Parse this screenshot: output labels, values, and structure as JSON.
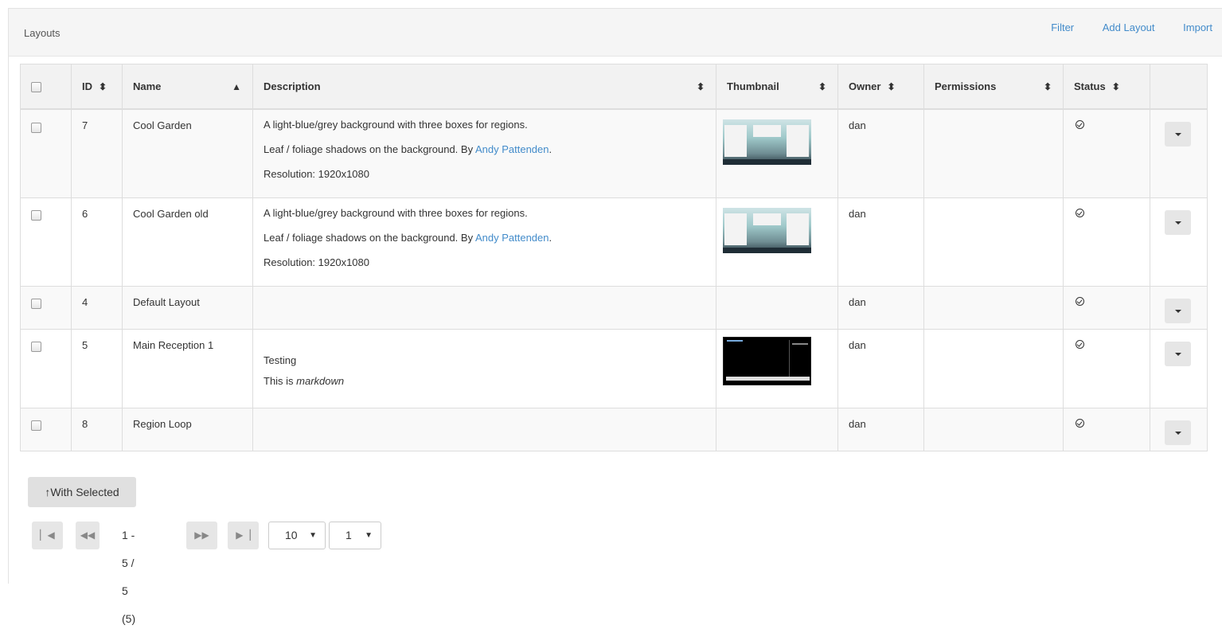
{
  "header": {
    "title": "Layouts",
    "links": [
      "Filter",
      "Add Layout",
      "Import"
    ]
  },
  "table": {
    "columns": [
      "ID",
      "Name",
      "Description",
      "Thumbnail",
      "Owner",
      "Permissions",
      "Status"
    ],
    "rows": [
      {
        "id": "7",
        "name": "Cool Garden",
        "desc1": "A light-blue/grey background with three boxes for regions.",
        "desc2_pre": "Leaf / foliage shadows on the background. By ",
        "desc2_link": "Andy Pattenden",
        "desc2_post": ".",
        "desc3": "Resolution: 1920x1080",
        "owner": "dan"
      },
      {
        "id": "6",
        "name": "Cool Garden old",
        "desc1": "A light-blue/grey background with three boxes for regions.",
        "desc2_pre": "Leaf / foliage shadows on the background. By ",
        "desc2_link": "Andy Pattenden",
        "desc2_post": ".",
        "desc3": "Resolution: 1920x1080",
        "owner": "dan"
      },
      {
        "id": "4",
        "name": "Default Layout",
        "owner": "dan"
      },
      {
        "id": "5",
        "name": "Main Reception 1",
        "desc1": "Testing",
        "desc2_pre": "This is ",
        "desc2_em": "markdown",
        "owner": "dan"
      },
      {
        "id": "8",
        "name": "Region Loop",
        "owner": "dan"
      }
    ]
  },
  "actions": {
    "with_selected": "With Selected"
  },
  "pager": {
    "info": "1 - 5 / 5 (5)",
    "page_size": "10",
    "page": "1"
  },
  "icons": {
    "first": "first-page-icon",
    "prev": "prev-page-icon",
    "next": "next-page-icon",
    "last": "last-page-icon",
    "status": "status-check-icon",
    "upload": "upload-arrow-icon"
  }
}
